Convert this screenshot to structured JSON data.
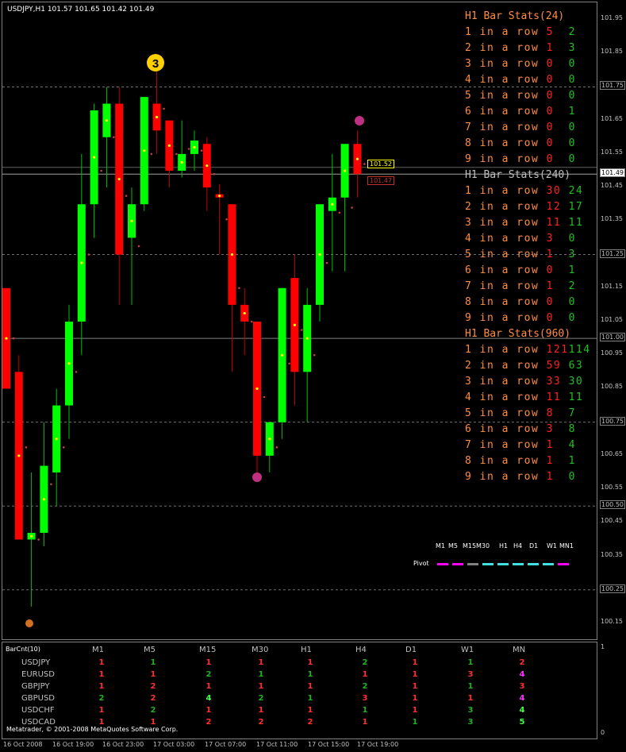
{
  "window": {
    "title": "USDJPY,H1  101.57 101.65 101.42 101.49"
  },
  "price_scale": {
    "labels": [
      "101.95",
      "101.85",
      "101.75",
      "101.65",
      "101.55",
      "101.49",
      "101.45",
      "101.35",
      "101.25",
      "101.15",
      "101.05",
      "101.00",
      "100.95",
      "100.85",
      "100.75",
      "100.65",
      "100.55",
      "100.50",
      "100.45",
      "100.35",
      "100.25",
      "100.15"
    ],
    "boxed": [
      "101.75",
      "101.25",
      "101.00",
      "100.75",
      "100.50",
      "100.25"
    ],
    "current": "101.49"
  },
  "price_tags": {
    "high": "101.52",
    "low": "101.47"
  },
  "markers": {
    "top_number": "3"
  },
  "stats": {
    "sections": [
      {
        "title": "H1 Bar Stats(24)",
        "title_color": "#ff8c40",
        "rows": [
          {
            "label": "1 in a row",
            "up": "5",
            "down": "2"
          },
          {
            "label": "2 in a row",
            "up": "1",
            "down": "3"
          },
          {
            "label": "3 in a row",
            "up": "0",
            "down": "0"
          },
          {
            "label": "4 in a row",
            "up": "0",
            "down": "0"
          },
          {
            "label": "5 in a row",
            "up": "0",
            "down": "0"
          },
          {
            "label": "6 in a row",
            "up": "0",
            "down": "1"
          },
          {
            "label": "7 in a row",
            "up": "0",
            "down": "0"
          },
          {
            "label": "8 in a row",
            "up": "0",
            "down": "0"
          },
          {
            "label": "9 in a row",
            "up": "0",
            "down": "0"
          }
        ]
      },
      {
        "title": "H1 Bar Stats(240)",
        "title_color": "#c0c0c0",
        "rows": [
          {
            "label": "1 in a row",
            "up": "30",
            "down": "24"
          },
          {
            "label": "2 in a row",
            "up": "12",
            "down": "17"
          },
          {
            "label": "3 in a row",
            "up": "11",
            "down": "11"
          },
          {
            "label": "4 in a row",
            "up": "3",
            "down": "0"
          },
          {
            "label": "5 in a row",
            "up": "1",
            "down": "3"
          },
          {
            "label": "6 in a row",
            "up": "0",
            "down": "1"
          },
          {
            "label": "7 in a row",
            "up": "1",
            "down": "2"
          },
          {
            "label": "8 in a row",
            "up": "0",
            "down": "0"
          },
          {
            "label": "9 in a row",
            "up": "0",
            "down": "0"
          }
        ]
      },
      {
        "title": "H1 Bar Stats(960)",
        "title_color": "#ff8c40",
        "rows": [
          {
            "label": "1 in a row",
            "up": "121",
            "down": "114"
          },
          {
            "label": "2 in a row",
            "up": "59",
            "down": "63"
          },
          {
            "label": "3 in a row",
            "up": "33",
            "down": "30"
          },
          {
            "label": "4 in a row",
            "up": "11",
            "down": "11"
          },
          {
            "label": "5 in a row",
            "up": "8",
            "down": "7"
          },
          {
            "label": "6 in a row",
            "up": "3",
            "down": "8"
          },
          {
            "label": "7 in a row",
            "up": "1",
            "down": "4"
          },
          {
            "label": "8 in a row",
            "up": "1",
            "down": "1"
          },
          {
            "label": "9 in a row",
            "up": "1",
            "down": "0"
          }
        ]
      }
    ],
    "label_color": "#ff8c40",
    "up_color": "#ff2020",
    "down_color": "#20c020"
  },
  "legend": {
    "timeframes": [
      "M1",
      "M5",
      "M15",
      "M30",
      "H1",
      "H4",
      "D1",
      "W1",
      "MN1"
    ],
    "pivot_label": "Pivot",
    "pivot_colors": [
      "#ff00ff",
      "#ff00ff",
      "#808080",
      "#40e0e0",
      "#40e0e0",
      "#40e0e0",
      "#40e0e0",
      "#40e0e0",
      "#ff00ff"
    ]
  },
  "barcount": {
    "name": "BarCnt(10)",
    "columns": [
      "M1",
      "M5",
      "M15",
      "M30",
      "H1",
      "H4",
      "D1",
      "W1",
      "MN"
    ],
    "rows": [
      {
        "symbol": "USDJPY",
        "values": [
          "1",
          "1",
          "1",
          "1",
          "1",
          "2",
          "1",
          "1",
          "2"
        ],
        "colors": [
          "r",
          "g",
          "r",
          "r",
          "r",
          "g",
          "r",
          "g",
          "r"
        ]
      },
      {
        "symbol": "EURUSD",
        "values": [
          "1",
          "1",
          "2",
          "1",
          "1",
          "1",
          "1",
          "3",
          "4"
        ],
        "colors": [
          "r",
          "r",
          "g",
          "g",
          "g",
          "r",
          "r",
          "r",
          "m"
        ]
      },
      {
        "symbol": "GBPJPY",
        "values": [
          "1",
          "2",
          "1",
          "1",
          "1",
          "2",
          "1",
          "1",
          "3"
        ],
        "colors": [
          "r",
          "r",
          "r",
          "r",
          "r",
          "g",
          "r",
          "g",
          "r"
        ]
      },
      {
        "symbol": "GBPUSD",
        "values": [
          "2",
          "2",
          "4",
          "2",
          "1",
          "3",
          "1",
          "1",
          "4"
        ],
        "colors": [
          "g",
          "r",
          "lg",
          "g",
          "g",
          "r",
          "r",
          "r",
          "m"
        ]
      },
      {
        "symbol": "USDCHF",
        "values": [
          "1",
          "2",
          "1",
          "1",
          "1",
          "1",
          "1",
          "3",
          "4"
        ],
        "colors": [
          "r",
          "g",
          "r",
          "r",
          "r",
          "g",
          "r",
          "g",
          "lg"
        ]
      },
      {
        "symbol": "USDCAD",
        "values": [
          "1",
          "1",
          "2",
          "2",
          "2",
          "1",
          "1",
          "3",
          "5"
        ],
        "colors": [
          "r",
          "r",
          "r",
          "r",
          "r",
          "r",
          "g",
          "g",
          "lg"
        ]
      }
    ],
    "copyright": "Metatrader, © 2001-2008 MetaQuotes Software Corp.",
    "scale_top": "1",
    "scale_bottom": "0"
  },
  "time_axis": {
    "labels": [
      "16 Oct 2008",
      "16 Oct 19:00",
      "16 Oct 23:00",
      "17 Oct 03:00",
      "17 Oct 07:00",
      "17 Oct 11:00",
      "17 Oct 15:00",
      "17 Oct 19:00"
    ]
  },
  "chart_data": {
    "type": "candlestick",
    "symbol": "USDJPY",
    "period": "H1",
    "ylim": [
      100.1,
      102.0
    ],
    "grid": false,
    "bull_color": "#00ff00",
    "bear_color": "#ff0000",
    "candles": [
      {
        "o": 101.15,
        "h": 101.15,
        "l": 100.85,
        "c": 100.85
      },
      {
        "o": 100.9,
        "h": 100.95,
        "l": 100.4,
        "c": 100.4
      },
      {
        "o": 100.4,
        "h": 100.6,
        "l": 100.2,
        "c": 100.42
      },
      {
        "o": 100.42,
        "h": 100.75,
        "l": 100.38,
        "c": 100.62
      },
      {
        "o": 100.6,
        "h": 100.85,
        "l": 100.5,
        "c": 100.8
      },
      {
        "o": 100.8,
        "h": 101.1,
        "l": 100.7,
        "c": 101.05
      },
      {
        "o": 101.05,
        "h": 101.55,
        "l": 100.95,
        "c": 101.4
      },
      {
        "o": 101.4,
        "h": 101.7,
        "l": 101.3,
        "c": 101.68
      },
      {
        "o": 101.6,
        "h": 101.75,
        "l": 101.45,
        "c": 101.7
      },
      {
        "o": 101.7,
        "h": 101.75,
        "l": 101.1,
        "c": 101.25
      },
      {
        "o": 101.3,
        "h": 101.45,
        "l": 101.1,
        "c": 101.4
      },
      {
        "o": 101.4,
        "h": 101.72,
        "l": 101.38,
        "c": 101.72
      },
      {
        "o": 101.7,
        "h": 101.82,
        "l": 101.55,
        "c": 101.62
      },
      {
        "o": 101.65,
        "h": 101.65,
        "l": 101.45,
        "c": 101.5
      },
      {
        "o": 101.5,
        "h": 101.65,
        "l": 101.48,
        "c": 101.55
      },
      {
        "o": 101.55,
        "h": 101.62,
        "l": 101.5,
        "c": 101.59
      },
      {
        "o": 101.58,
        "h": 101.6,
        "l": 101.38,
        "c": 101.45
      },
      {
        "o": 101.43,
        "h": 101.46,
        "l": 101.25,
        "c": 101.42
      },
      {
        "o": 101.4,
        "h": 101.4,
        "l": 100.9,
        "c": 101.1
      },
      {
        "o": 101.1,
        "h": 101.15,
        "l": 100.95,
        "c": 101.05
      },
      {
        "o": 101.05,
        "h": 101.05,
        "l": 100.6,
        "c": 100.65
      },
      {
        "o": 100.65,
        "h": 100.75,
        "l": 100.6,
        "c": 100.75
      },
      {
        "o": 100.75,
        "h": 101.15,
        "l": 100.7,
        "c": 101.15
      },
      {
        "o": 101.18,
        "h": 101.25,
        "l": 100.8,
        "c": 100.9
      },
      {
        "o": 100.9,
        "h": 101.15,
        "l": 100.75,
        "c": 101.1
      },
      {
        "o": 101.1,
        "h": 101.4,
        "l": 101.05,
        "c": 101.4
      },
      {
        "o": 101.38,
        "h": 101.55,
        "l": 101.2,
        "c": 101.42
      },
      {
        "o": 101.42,
        "h": 101.58,
        "l": 101.2,
        "c": 101.58
      },
      {
        "o": 101.58,
        "h": 101.62,
        "l": 101.42,
        "c": 101.49
      }
    ]
  }
}
